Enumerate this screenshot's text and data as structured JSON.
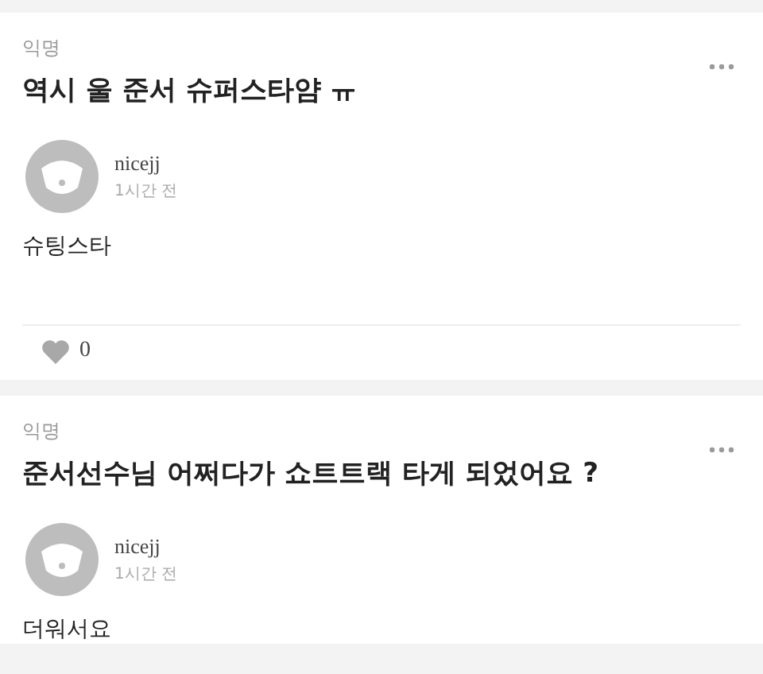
{
  "posts": [
    {
      "board": "익명",
      "title": "역시 울 준서 슈퍼스타얌 ㅠ",
      "author": "nicejj",
      "time": "1시간 전",
      "body": "슈팅스타",
      "likes": "0"
    },
    {
      "board": "익명",
      "title": "준서선수님 어쩌다가 쇼트트랙 타게 되었어요 ?",
      "author": "nicejj",
      "time": "1시간 전",
      "body": "더워서요"
    }
  ]
}
